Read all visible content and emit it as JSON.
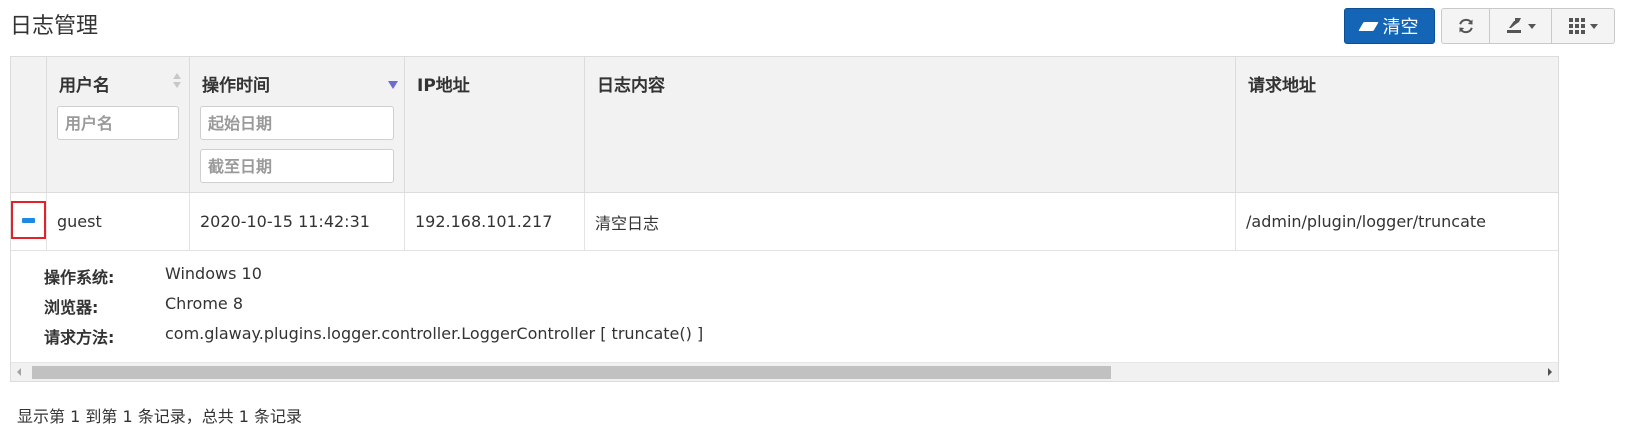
{
  "page": {
    "title": "日志管理"
  },
  "toolbar": {
    "clear_label": "清空",
    "refresh_icon": "refresh-icon",
    "export_icon": "export-icon",
    "columns_icon": "columns-grid-icon"
  },
  "table": {
    "columns": [
      {
        "label": "用户名",
        "filter_placeholder": "用户名",
        "sort": "both"
      },
      {
        "label": "操作时间",
        "filter_start_placeholder": "起始日期",
        "filter_end_placeholder": "截至日期",
        "sort": "desc"
      },
      {
        "label": "IP地址"
      },
      {
        "label": "日志内容"
      },
      {
        "label": "请求地址"
      }
    ],
    "rows": [
      {
        "username": "guest",
        "time": "2020-10-15 11:42:31",
        "ip": "192.168.101.217",
        "content": "清空日志",
        "url": "/admin/plugin/logger/truncate",
        "detail": {
          "os_label": "操作系统:",
          "os": "Windows 10",
          "browser_label": "浏览器:",
          "browser": "Chrome 8",
          "method_label": "请求方法:",
          "method": "com.glaway.plugins.logger.controller.LoggerController [ truncate() ]"
        }
      }
    ]
  },
  "pagination": {
    "summary": "显示第 1 到第 1 条记录，总共 1 条记录"
  },
  "colors": {
    "primary": "#1565b7",
    "header_bg": "#f2f2f2",
    "highlight_border": "#e0232a",
    "sort_active": "#6b6bd6"
  }
}
